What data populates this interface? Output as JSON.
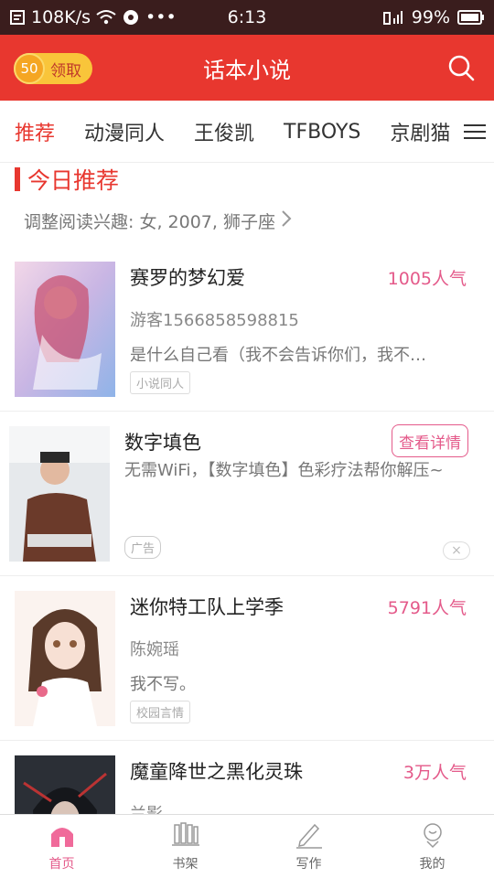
{
  "status_bar": {
    "speed": "108K/s",
    "time": "6:13",
    "battery": "99%",
    "dots": "•••"
  },
  "header": {
    "coin_value": "50",
    "reward_label": "领取",
    "title": "话本小说",
    "search_icon": "search-icon"
  },
  "tabs": [
    "推荐",
    "动漫同人",
    "王俊凯",
    "TFBOYS",
    "京剧猫"
  ],
  "section": {
    "title": "今日推荐",
    "prefs": "调整阅读兴趣: 女, 2007, 狮子座"
  },
  "items": [
    {
      "title": "赛罗的梦幻爱",
      "popularity": "1005人气",
      "author": "游客1566858598815",
      "desc": "是什么自己看（我不会告诉你们，我不…",
      "tag": "小说同人"
    },
    {
      "title": "迷你特工队上学季",
      "popularity": "5791人气",
      "author": "陈婉瑶",
      "desc": "我不写。",
      "tag": "校园言情"
    },
    {
      "title": "魔童降世之黑化灵珠",
      "popularity": "3万人气",
      "author": "兰影",
      "desc": "",
      "tag": ""
    }
  ],
  "ad": {
    "title": "数字填色",
    "detail_label": "查看详情",
    "desc": "无需WiFi，【数字填色】色彩疗法帮你解压~",
    "badge": "广告",
    "close": "×"
  },
  "bottom_nav": [
    {
      "label": "首页",
      "icon": "home-icon"
    },
    {
      "label": "书架",
      "icon": "bookshelf-icon"
    },
    {
      "label": "写作",
      "icon": "pen-icon"
    },
    {
      "label": "我的",
      "icon": "profile-icon"
    }
  ],
  "colors": {
    "brand": "#e8372f",
    "accent_pink": "#e45a8a",
    "coin": "#f9c53a"
  }
}
